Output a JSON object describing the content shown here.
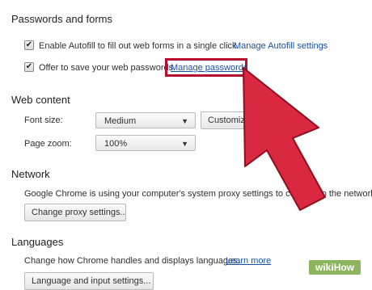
{
  "passwords": {
    "title": "Passwords and forms",
    "autofill_label": "Enable Autofill to fill out web forms in a single click.",
    "autofill_link": "Manage Autofill settings",
    "save_label": "Offer to save your web passwords.",
    "save_link": "Manage passwords"
  },
  "web_content": {
    "title": "Web content",
    "font_size_label": "Font size:",
    "font_size_value": "Medium",
    "customize_button": "Customize fonts...",
    "page_zoom_label": "Page zoom:",
    "page_zoom_value": "100%"
  },
  "network": {
    "title": "Network",
    "description": "Google Chrome is using your computer's system proxy settings to connect to the network.",
    "proxy_button": "Change proxy settings..."
  },
  "languages": {
    "title": "Languages",
    "description": "Change how Chrome handles and displays languages.",
    "learn_more": "Learn more",
    "language_button": "Language and input settings..."
  },
  "annotation": {
    "arrow_color": "#d9283f",
    "arrow_stroke": "#8e0f20",
    "highlight_color": "#b80d2e"
  },
  "watermark": {
    "wiki": "wiki",
    "how": "How",
    "color": "#8db55d"
  }
}
